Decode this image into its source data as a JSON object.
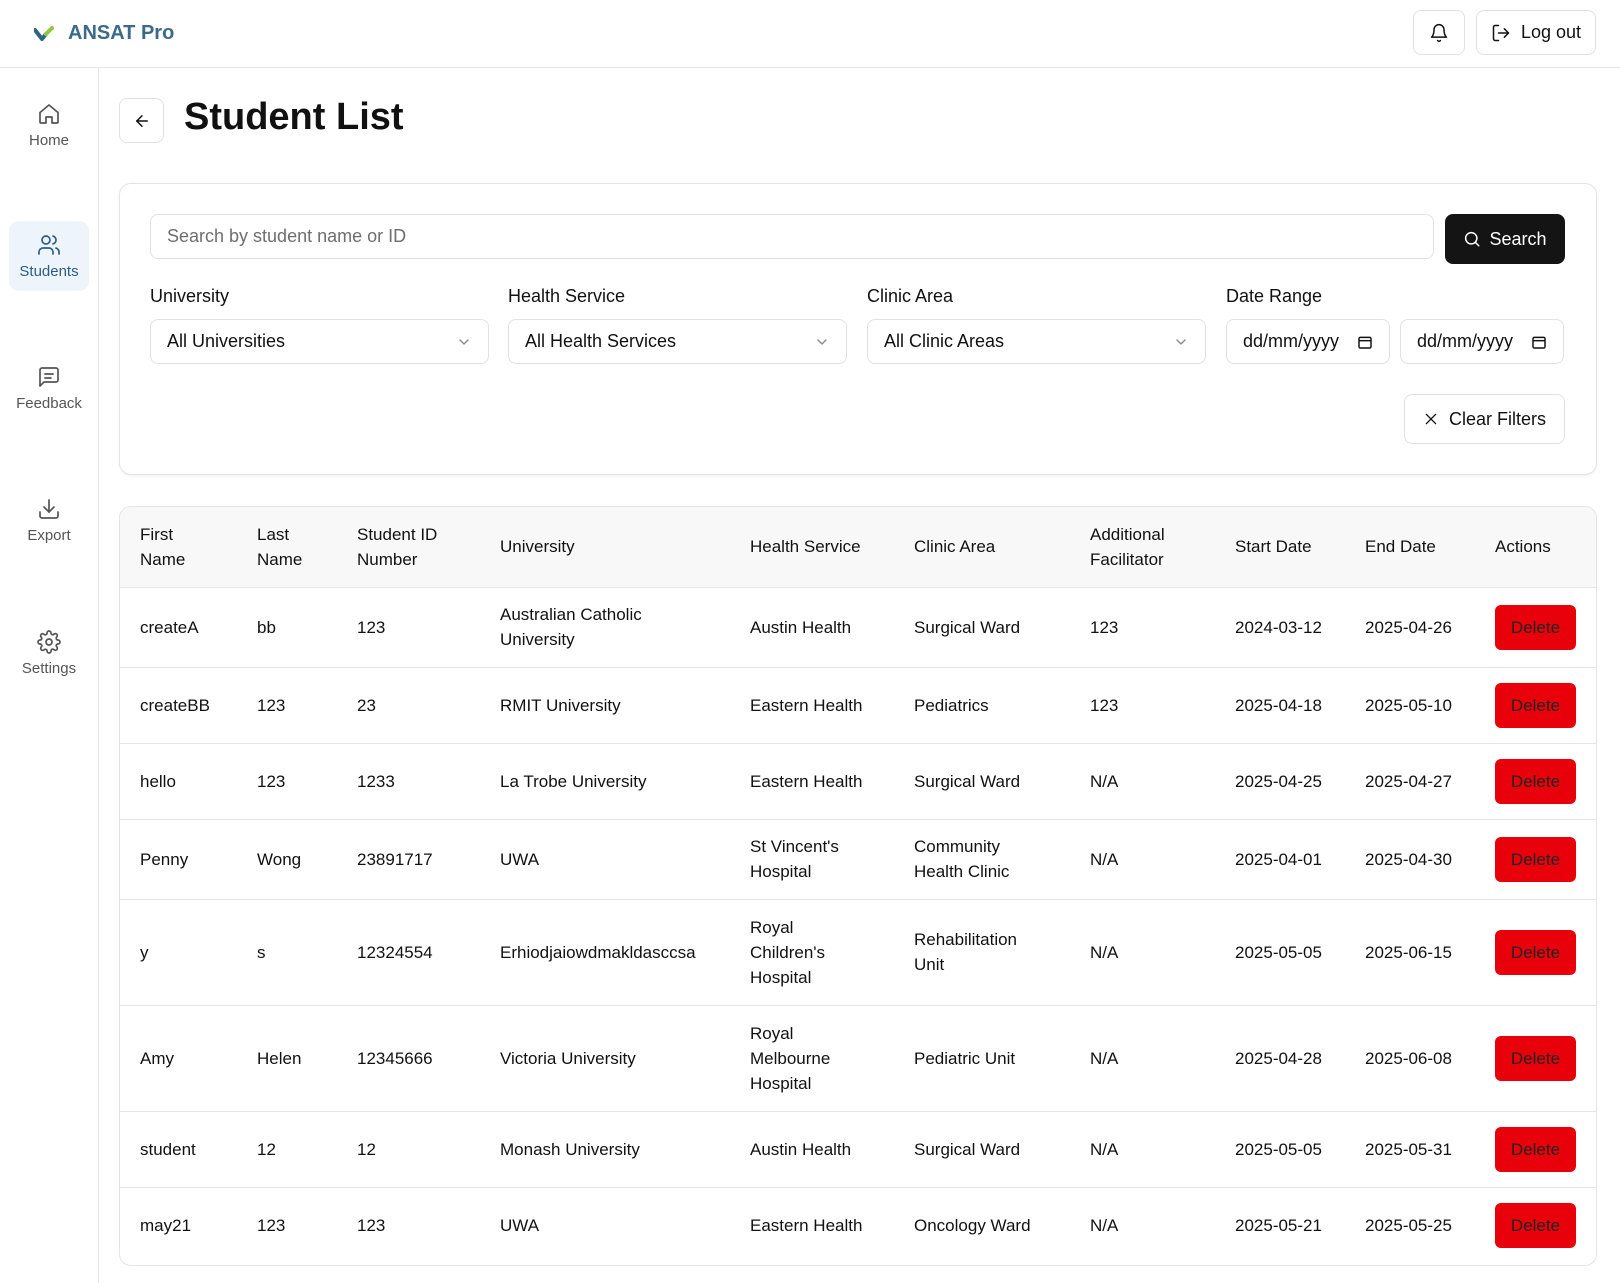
{
  "app": {
    "name": "ANSAT Pro",
    "logout_label": "Log out"
  },
  "sidebar": {
    "items": [
      {
        "label": "Home",
        "icon": "home-icon"
      },
      {
        "label": "Students",
        "icon": "users-icon",
        "active": true
      },
      {
        "label": "Feedback",
        "icon": "message-icon"
      },
      {
        "label": "Export",
        "icon": "download-icon"
      },
      {
        "label": "Settings",
        "icon": "gear-icon"
      }
    ]
  },
  "page": {
    "title": "Student List"
  },
  "filters": {
    "search_placeholder": "Search by student name or ID",
    "search_button": "Search",
    "university_label": "University",
    "university_value": "All Universities",
    "health_service_label": "Health Service",
    "health_service_value": "All Health Services",
    "clinic_area_label": "Clinic Area",
    "clinic_area_value": "All Clinic Areas",
    "date_range_label": "Date Range",
    "date_from": "dd/mm/yyyy",
    "date_to": "dd/mm/yyyy",
    "clear_button": "Clear Filters"
  },
  "table": {
    "headers": [
      "First Name",
      "Last Name",
      "Student ID Number",
      "University",
      "Health Service",
      "Clinic Area",
      "Additional Facilitator",
      "Start Date",
      "End Date",
      "Actions"
    ],
    "delete_label": "Delete",
    "rows": [
      {
        "first": "createA",
        "last": "bb",
        "id": "123",
        "university": "Australian Catholic University",
        "service": "Austin Health",
        "clinic": "Surgical Ward",
        "facilitator": "123",
        "start": "2024-03-12",
        "end": "2025-04-26"
      },
      {
        "first": "createBB",
        "last": "123",
        "id": "23",
        "university": "RMIT University",
        "service": "Eastern Health",
        "clinic": "Pediatrics",
        "facilitator": "123",
        "start": "2025-04-18",
        "end": "2025-05-10"
      },
      {
        "first": "hello",
        "last": "123",
        "id": "1233",
        "university": "La Trobe University",
        "service": "Eastern Health",
        "clinic": "Surgical Ward",
        "facilitator": "N/A",
        "start": "2025-04-25",
        "end": "2025-04-27"
      },
      {
        "first": "Penny",
        "last": "Wong",
        "id": "23891717",
        "university": "UWA",
        "service": "St Vincent's Hospital",
        "clinic": "Community Health Clinic",
        "facilitator": "N/A",
        "start": "2025-04-01",
        "end": "2025-04-30"
      },
      {
        "first": "y",
        "last": "s",
        "id": "12324554",
        "university": "Erhiodjaiowdmakldasccsa",
        "service": "Royal Children's Hospital",
        "clinic": "Rehabilitation Unit",
        "facilitator": "N/A",
        "start": "2025-05-05",
        "end": "2025-06-15"
      },
      {
        "first": "Amy",
        "last": "Helen",
        "id": "12345666",
        "university": "Victoria University",
        "service": "Royal Melbourne Hospital",
        "clinic": "Pediatric Unit",
        "facilitator": "N/A",
        "start": "2025-04-28",
        "end": "2025-06-08"
      },
      {
        "first": "student",
        "last": "12",
        "id": "12",
        "university": "Monash University",
        "service": "Austin Health",
        "clinic": "Surgical Ward",
        "facilitator": "N/A",
        "start": "2025-05-05",
        "end": "2025-05-31"
      },
      {
        "first": "may21",
        "last": "123",
        "id": "123",
        "university": "UWA",
        "service": "Eastern Health",
        "clinic": "Oncology Ward",
        "facilitator": "N/A",
        "start": "2025-05-21",
        "end": "2025-05-25"
      }
    ]
  },
  "colors": {
    "brand": "#3a6b8a",
    "logo_green": "#8dc63f",
    "active_nav_bg": "#eef4fb",
    "delete_red": "#e8000b",
    "search_button_bg": "#141414"
  }
}
